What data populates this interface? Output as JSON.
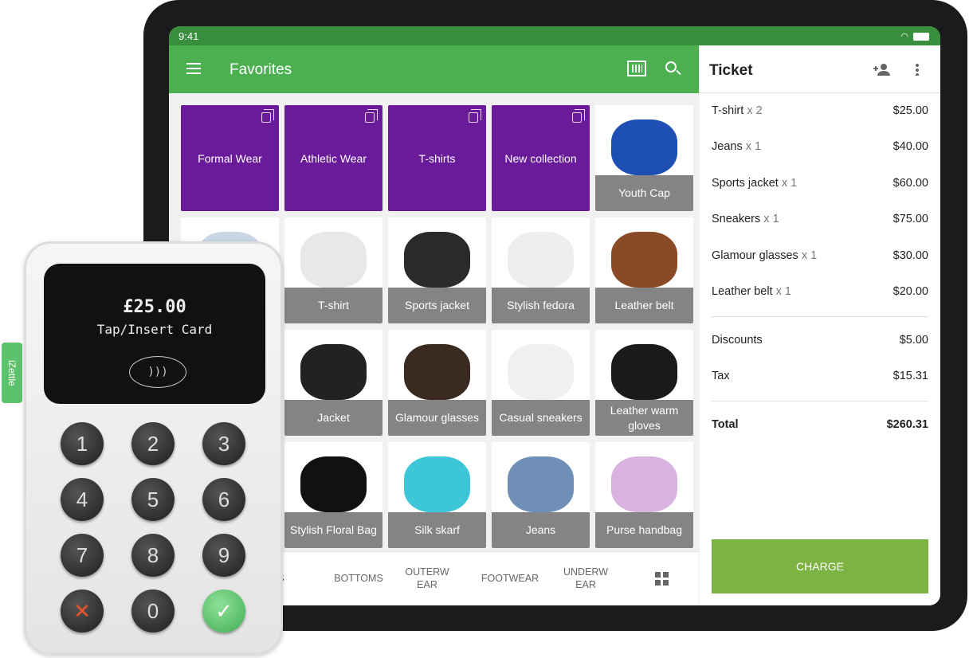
{
  "status": {
    "time": "9:41"
  },
  "appbar": {
    "title": "Favorites",
    "icons": [
      "menu-icon",
      "barcode-icon",
      "search-icon"
    ]
  },
  "colors": {
    "primary": "#4caf50",
    "status": "#388e3c",
    "category": "#6a1b9a",
    "charge": "#7cb342"
  },
  "tiles": [
    {
      "type": "category",
      "label": "Formal Wear"
    },
    {
      "type": "category",
      "label": "Athletic Wear"
    },
    {
      "type": "category",
      "label": "T-shirts"
    },
    {
      "type": "category",
      "label": "New collection"
    },
    {
      "type": "product",
      "label": "Youth Cap",
      "color": "#1e4fb5"
    },
    {
      "type": "product",
      "label": "",
      "color": "#c8d6e6"
    },
    {
      "type": "product",
      "label": "T-shirt",
      "color": "#e8e8e8"
    },
    {
      "type": "product",
      "label": "Sports jacket",
      "color": "#2a2a2a"
    },
    {
      "type": "product",
      "label": "Stylish fedora",
      "color": "#eeeeee"
    },
    {
      "type": "product",
      "label": "Leather belt",
      "color": "#8a4a26"
    },
    {
      "type": "product",
      "label": "",
      "color": "#ddd"
    },
    {
      "type": "product",
      "label": "Jacket",
      "color": "#222"
    },
    {
      "type": "product",
      "label": "Glamour glasses",
      "color": "#3a2a20"
    },
    {
      "type": "product",
      "label": "Casual sneakers",
      "color": "#f0f0f0"
    },
    {
      "type": "product",
      "label": "Leather warm gloves",
      "color": "#1a1a1a"
    },
    {
      "type": "product",
      "label": "",
      "color": "#ddd"
    },
    {
      "type": "product",
      "label": "Stylish Floral Bag",
      "color": "#111"
    },
    {
      "type": "product",
      "label": "Silk skarf",
      "color": "#3cc6d8"
    },
    {
      "type": "product",
      "label": "Jeans",
      "color": "#6f8fb8"
    },
    {
      "type": "product",
      "label": "Purse handbag",
      "color": "#d9b3e0"
    }
  ],
  "tabs": [
    "PS",
    "BOTTOMS",
    "OUTERW EAR",
    "FOOTWEAR",
    "UNDERW EAR"
  ],
  "ticket": {
    "title": "Ticket",
    "items": [
      {
        "name": "T-shirt",
        "qty": "x 2",
        "price": "$25.00"
      },
      {
        "name": "Jeans",
        "qty": "x 1",
        "price": "$40.00"
      },
      {
        "name": "Sports jacket",
        "qty": " x 1",
        "price": "$60.00"
      },
      {
        "name": "Sneakers",
        "qty": "x 1",
        "price": "$75.00"
      },
      {
        "name": "Glamour glasses",
        "qty": "x 1",
        "price": "$30.00"
      },
      {
        "name": "Leather belt",
        "qty": " x 1",
        "price": "$20.00"
      }
    ],
    "discounts_label": "Discounts",
    "discounts": "$5.00",
    "tax_label": "Tax",
    "tax": "$15.31",
    "total_label": "Total",
    "total": "$260.31",
    "charge": "CHARGE"
  },
  "reader": {
    "amount": "£25.00",
    "message": "Tap/Insert Card",
    "brand": "iZettle",
    "keys": [
      "1",
      "2",
      "3",
      "4",
      "5",
      "6",
      "7",
      "8",
      "9",
      "✕",
      "0",
      "✓"
    ]
  }
}
